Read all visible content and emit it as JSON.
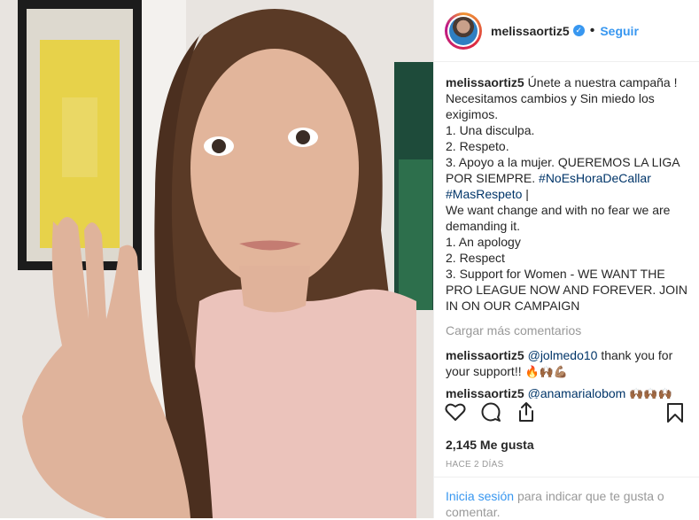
{
  "post": {
    "username": "melissaortiz5",
    "verified_icon": "verified-check-icon",
    "follow_label": "Seguir",
    "caption_lines": [
      "Únete a nuestra campaña !",
      "Necesitamos cambios y Sin miedo los exigimos.",
      "1. Una disculpa.",
      "2. Respeto.",
      "3. Apoyo a la mujer. QUEREMOS LA LIGA POR SIEMPRE.",
      "#NoEsHoraDeCallar",
      "#MasRespeto",
      "|",
      "We want change and with no fear we are demanding it.",
      "1. An apology",
      "2. Respect",
      "3. Support for Women - WE WANT THE PRO LEAGUE NOW AND FOREVER. JOIN IN ON OUR CAMPAIGN"
    ],
    "load_more": "Cargar más comentarios",
    "comments": [
      {
        "user": "melissaortiz5",
        "mention": "@jolmedo10",
        "text": "thank you for your support!!",
        "emoji": "🔥🙌🏾💪🏽"
      },
      {
        "user": "melissaortiz5",
        "mention": "@anamarialobom",
        "text": "",
        "emoji": "🙌🏾🙌🏾🙌🏾"
      }
    ],
    "likes": "2,145 Me gusta",
    "time": "HACE 2 DÍAS",
    "login_link": "Inicia sesión",
    "login_text": "para indicar que te gusta o comentar."
  },
  "icons": [
    "heart-icon",
    "comment-icon",
    "share-icon",
    "bookmark-icon"
  ],
  "colors": {
    "link": "#3897f0",
    "hashtag": "#003569",
    "muted": "#999999"
  }
}
